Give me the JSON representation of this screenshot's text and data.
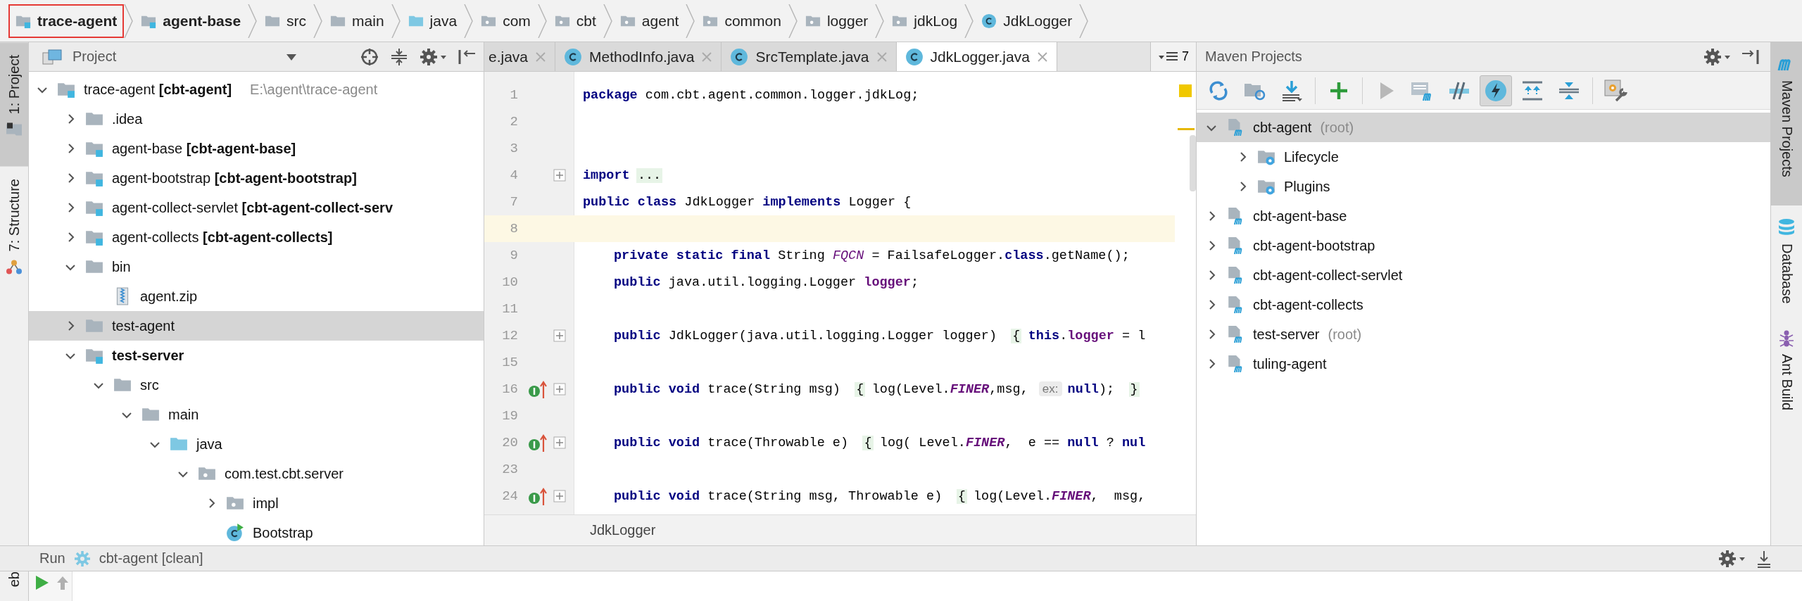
{
  "breadcrumbs": [
    {
      "label": "trace-agent",
      "kind": "module",
      "bold": true,
      "highlighted": true
    },
    {
      "label": "agent-base",
      "kind": "module",
      "bold": true,
      "highlighted": false
    },
    {
      "label": "src",
      "kind": "folder",
      "bold": false,
      "highlighted": false
    },
    {
      "label": "main",
      "kind": "folder",
      "bold": false,
      "highlighted": false
    },
    {
      "label": "java",
      "kind": "source",
      "bold": false,
      "highlighted": false
    },
    {
      "label": "com",
      "kind": "package",
      "bold": false,
      "highlighted": false
    },
    {
      "label": "cbt",
      "kind": "package",
      "bold": false,
      "highlighted": false
    },
    {
      "label": "agent",
      "kind": "package",
      "bold": false,
      "highlighted": false
    },
    {
      "label": "common",
      "kind": "package",
      "bold": false,
      "highlighted": false
    },
    {
      "label": "logger",
      "kind": "package",
      "bold": false,
      "highlighted": false
    },
    {
      "label": "jdkLog",
      "kind": "package",
      "bold": false,
      "highlighted": false
    },
    {
      "label": "JdkLogger",
      "kind": "class",
      "bold": false,
      "highlighted": false
    }
  ],
  "left_strip": [
    {
      "label": "1: Project",
      "kind": "project",
      "selected": true
    },
    {
      "label": "7: Structure",
      "kind": "structure",
      "selected": false
    }
  ],
  "project": {
    "title": "Project",
    "tree": [
      {
        "label": "trace-agent **[cbt-agent]**",
        "path": "E:\\agent\\trace-agent",
        "kind": "module",
        "bold": false,
        "expanded": true,
        "selected": false,
        "children": [
          {
            "label": ".idea",
            "kind": "folder",
            "bold": false,
            "expanded": false,
            "selected": false
          },
          {
            "label": "agent-base **[cbt-agent-base]**",
            "kind": "module",
            "bold": false,
            "expanded": false,
            "selected": false
          },
          {
            "label": "agent-bootstrap **[cbt-agent-bootstrap]**",
            "kind": "module",
            "bold": false,
            "expanded": false,
            "selected": false
          },
          {
            "label": "agent-collect-servlet **[cbt-agent-collect-serv**",
            "kind": "module",
            "bold": false,
            "expanded": false,
            "selected": false
          },
          {
            "label": "agent-collects **[cbt-agent-collects]**",
            "kind": "module",
            "bold": false,
            "expanded": false,
            "selected": false
          },
          {
            "label": "bin",
            "kind": "folder",
            "bold": false,
            "expanded": true,
            "selected": false,
            "children": [
              {
                "label": "agent.zip",
                "kind": "zip",
                "bold": false,
                "selected": false
              }
            ]
          },
          {
            "label": "test-agent",
            "kind": "folder",
            "bold": false,
            "expanded": false,
            "selected": true
          },
          {
            "label": "test-server",
            "kind": "module",
            "bold": true,
            "expanded": true,
            "selected": false,
            "children": [
              {
                "label": "src",
                "kind": "folder",
                "bold": false,
                "expanded": true,
                "selected": false,
                "children": [
                  {
                    "label": "main",
                    "kind": "folder",
                    "bold": false,
                    "expanded": true,
                    "selected": false,
                    "children": [
                      {
                        "label": "java",
                        "kind": "source",
                        "bold": false,
                        "expanded": true,
                        "selected": false,
                        "children": [
                          {
                            "label": "com.test.cbt.server",
                            "kind": "package",
                            "bold": false,
                            "expanded": true,
                            "selected": false,
                            "children": [
                              {
                                "label": "impl",
                                "kind": "package",
                                "bold": false,
                                "expanded": false,
                                "selected": false
                              },
                              {
                                "label": "Bootstrap",
                                "kind": "class-run",
                                "bold": false,
                                "selected": false
                              }
                            ]
                          }
                        ]
                      }
                    ]
                  }
                ]
              }
            ]
          }
        ]
      }
    ]
  },
  "editor": {
    "tabs": [
      {
        "label": "e.java",
        "cut": true,
        "selected": false
      },
      {
        "label": "MethodInfo.java",
        "cut": false,
        "selected": false
      },
      {
        "label": "SrcTemplate.java",
        "cut": false,
        "selected": false
      },
      {
        "label": "JdkLogger.java",
        "cut": false,
        "selected": true
      }
    ],
    "overflow_count": "7",
    "lines": [
      {
        "number": "1",
        "indent": false,
        "foldable": false,
        "overrides": false,
        "current": false,
        "segments": [
          {
            "kind": "kw",
            "text": "package"
          },
          {
            "kind": "plain",
            "text": " com.cbt.agent.common.logger.jdkLog;"
          }
        ]
      },
      {
        "number": "2",
        "foldable": false,
        "overrides": false,
        "current": false
      },
      {
        "number": "3",
        "foldable": false,
        "overrides": false,
        "current": false
      },
      {
        "number": "4",
        "indent": false,
        "foldable": true,
        "overrides": false,
        "current": false,
        "segments": [
          {
            "kind": "kw",
            "text": "import"
          },
          {
            "kind": "fold",
            "text": "..."
          }
        ]
      },
      {
        "number": "7",
        "indent": false,
        "foldable": false,
        "overrides": false,
        "current": false,
        "segments": [
          {
            "kind": "kw",
            "text": "public class"
          },
          {
            "kind": "plain",
            "text": " JdkLogger "
          },
          {
            "kind": "kw",
            "text": "implements"
          },
          {
            "kind": "plain",
            "text": " Logger {"
          }
        ]
      },
      {
        "number": "8",
        "foldable": false,
        "overrides": false,
        "current": true
      },
      {
        "number": "9",
        "indent": true,
        "foldable": false,
        "overrides": false,
        "current": false,
        "segments": [
          {
            "kind": "kw",
            "text": "private static final"
          },
          {
            "kind": "plain",
            "text": " String "
          },
          {
            "kind": "const",
            "text": "FQCN"
          },
          {
            "kind": "plain",
            "text": " = FailsafeLogger."
          },
          {
            "kind": "kw",
            "text": "class"
          },
          {
            "kind": "plain",
            "text": ".getName();"
          }
        ]
      },
      {
        "number": "10",
        "indent": true,
        "foldable": false,
        "overrides": false,
        "current": false,
        "segments": [
          {
            "kind": "kw",
            "text": "public"
          },
          {
            "kind": "plain",
            "text": " java.util.logging.Logger "
          },
          {
            "kind": "field",
            "text": "logger"
          },
          {
            "kind": "plain",
            "text": ";"
          }
        ]
      },
      {
        "number": "11",
        "foldable": false,
        "overrides": false,
        "current": false
      },
      {
        "number": "12",
        "indent": true,
        "foldable": true,
        "overrides": false,
        "current": false,
        "segments": [
          {
            "kind": "kw",
            "text": "public"
          },
          {
            "kind": "plain",
            "text": " JdkLogger(java.util.logging.Logger logger) "
          },
          {
            "kind": "fold",
            "text": "{"
          },
          {
            "kind": "kw",
            "text": "this"
          },
          {
            "kind": "plain",
            "text": "."
          },
          {
            "kind": "field",
            "text": "logger"
          },
          {
            "kind": "plain",
            "text": " = l"
          }
        ]
      },
      {
        "number": "15",
        "foldable": false,
        "overrides": false,
        "current": false
      },
      {
        "number": "16",
        "indent": true,
        "foldable": true,
        "overrides": true,
        "current": false,
        "segments": [
          {
            "kind": "kw",
            "text": "public void"
          },
          {
            "kind": "plain",
            "text": " trace(String msg) "
          },
          {
            "kind": "fold",
            "text": "{"
          },
          {
            "kind": "plain",
            "text": "log(Level."
          },
          {
            "kind": "static",
            "text": "FINER"
          },
          {
            "kind": "plain",
            "text": ",msg, "
          },
          {
            "kind": "hint",
            "text": "ex:"
          },
          {
            "kind": "kw",
            "text": "null"
          },
          {
            "kind": "plain",
            "text": "); "
          },
          {
            "kind": "fold",
            "text": "}"
          }
        ]
      },
      {
        "number": "19",
        "foldable": false,
        "overrides": false,
        "current": false
      },
      {
        "number": "20",
        "indent": true,
        "foldable": true,
        "overrides": true,
        "current": false,
        "segments": [
          {
            "kind": "kw",
            "text": "public void"
          },
          {
            "kind": "plain",
            "text": " trace(Throwable e) "
          },
          {
            "kind": "fold",
            "text": "{"
          },
          {
            "kind": "plain",
            "text": "log( Level."
          },
          {
            "kind": "static",
            "text": "FINER"
          },
          {
            "kind": "plain",
            "text": ",  e == "
          },
          {
            "kind": "kw",
            "text": "null"
          },
          {
            "kind": "plain",
            "text": " ? "
          },
          {
            "kind": "kw",
            "text": "nul"
          }
        ]
      },
      {
        "number": "23",
        "foldable": false,
        "overrides": false,
        "current": false
      },
      {
        "number": "24",
        "indent": true,
        "foldable": true,
        "overrides": true,
        "current": false,
        "segments": [
          {
            "kind": "kw",
            "text": "public void"
          },
          {
            "kind": "plain",
            "text": " trace(String msg, Throwable e) "
          },
          {
            "kind": "fold",
            "text": "{"
          },
          {
            "kind": "plain",
            "text": "log(Level."
          },
          {
            "kind": "static",
            "text": "FINER"
          },
          {
            "kind": "plain",
            "text": ",  msg,"
          }
        ]
      }
    ],
    "breadcrumb": "JdkLogger"
  },
  "maven": {
    "title": "Maven Projects",
    "toolbar_groups": [
      {
        "buttons": [
          {
            "kind": "reimport",
            "selected": false
          },
          {
            "kind": "generate",
            "selected": false
          },
          {
            "kind": "download",
            "selected": false
          }
        ]
      },
      {
        "buttons": [
          {
            "kind": "add",
            "selected": false
          }
        ]
      },
      {
        "buttons": [
          {
            "kind": "run",
            "selected": false
          },
          {
            "kind": "goal",
            "selected": false
          },
          {
            "kind": "offline",
            "selected": false
          },
          {
            "kind": "skip-tests",
            "selected": true
          },
          {
            "kind": "expand",
            "selected": false
          },
          {
            "kind": "collapse",
            "selected": false
          }
        ]
      },
      {
        "buttons": [
          {
            "kind": "settings",
            "selected": false
          }
        ]
      }
    ],
    "tree": [
      {
        "label": "cbt-agent",
        "note": "(root)",
        "kind": "maven",
        "expanded": true,
        "selected": true,
        "children": [
          {
            "label": "Lifecycle",
            "kind": "lifecycle",
            "expanded": false,
            "selected": false
          },
          {
            "label": "Plugins",
            "kind": "lifecycle",
            "expanded": false,
            "selected": false
          }
        ]
      },
      {
        "label": "cbt-agent-base",
        "kind": "maven",
        "expanded": false,
        "selected": false
      },
      {
        "label": "cbt-agent-bootstrap",
        "kind": "maven",
        "expanded": false,
        "selected": false
      },
      {
        "label": "cbt-agent-collect-servlet",
        "kind": "maven",
        "expanded": false,
        "selected": false
      },
      {
        "label": "cbt-agent-collects",
        "kind": "maven",
        "expanded": false,
        "selected": false
      },
      {
        "label": "test-server",
        "note": "(root)",
        "kind": "maven",
        "expanded": false,
        "selected": false
      },
      {
        "label": "tuling-agent",
        "kind": "maven",
        "expanded": false,
        "selected": false
      }
    ]
  },
  "right_strip": [
    {
      "label": "Maven Projects",
      "kind": "maven",
      "selected": true
    },
    {
      "label": "Database",
      "kind": "database",
      "selected": false
    },
    {
      "label": "Ant Build",
      "kind": "ant",
      "selected": false
    }
  ],
  "run": {
    "label": "Run",
    "config": "cbt-agent [clean]",
    "side_tab": "eb"
  }
}
